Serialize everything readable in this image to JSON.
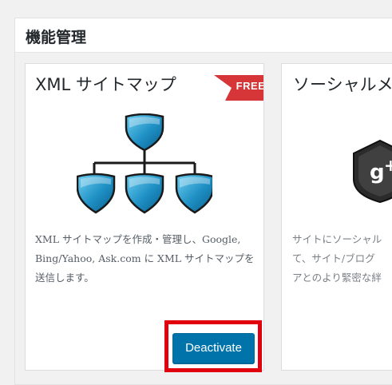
{
  "panel": {
    "title": "機能管理"
  },
  "cards": [
    {
      "title": "XML サイトマップ",
      "badge": "FREE",
      "icon": "sitemap-hierarchy-icon",
      "description": "XML サイトマップを作成・管理し、Google, Bing/Yahoo, Ask.com に XML サイトマップを送信します。",
      "button_label": "Deactivate"
    },
    {
      "title": "ソーシャルメ",
      "icon": "google-plus-icon",
      "description_lines": [
        "サイトにソーシャル",
        "て、サイト/ブログ",
        "アとのより緊密な絆"
      ]
    }
  ],
  "colors": {
    "button": "#0073aa",
    "badge": "#d63638",
    "highlight": "#e0000e"
  }
}
